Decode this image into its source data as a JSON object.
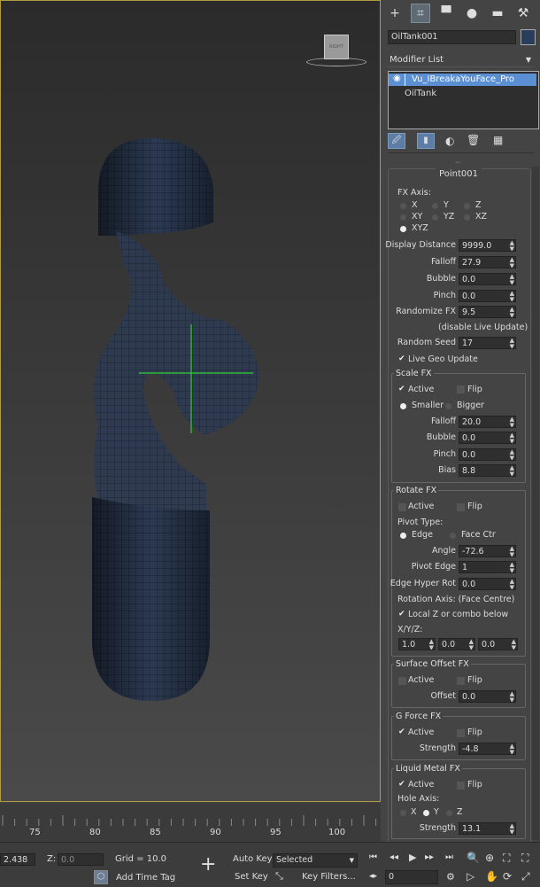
{
  "viewport": {
    "viewcube_label": "RIGHT"
  },
  "panel": {
    "tab_icons": [
      "create-icon",
      "modify-icon",
      "hierarchy-icon",
      "motion-icon",
      "display-icon",
      "utilities-icon"
    ],
    "object_name": "OilTank001",
    "modifier_list_label": "Modifier List",
    "stack": [
      "Vu_IBreakaYouFace_Pro",
      "OilTank"
    ],
    "rollout_title": "Point001",
    "fx_axis_label": "FX Axis:",
    "axis_options": [
      "X",
      "Y",
      "Z",
      "XY",
      "YZ",
      "XZ",
      "XYZ"
    ],
    "axis_selected": "XYZ",
    "display_distance_label": "Display Distance",
    "display_distance": "9999.0",
    "falloff_label": "Falloff",
    "falloff": "27.9",
    "bubble_label": "Bubble",
    "bubble": "0.0",
    "pinch_label": "Pinch",
    "pinch": "0.0",
    "randomize_fx_label": "Randomize FX",
    "randomize_fx": "9.5",
    "disable_live_update": "(disable Live Update)",
    "random_seed_label": "Random Seed",
    "random_seed": "17",
    "live_geo_update": "Live Geo Update",
    "scale_fx": {
      "title": "Scale FX",
      "active": "Active",
      "flip": "Flip",
      "smaller": "Smaller",
      "bigger": "Bigger",
      "falloff_label": "Falloff",
      "falloff": "20.0",
      "bubble_label": "Bubble",
      "bubble": "0.0",
      "pinch_label": "Pinch",
      "pinch": "0.0",
      "bias_label": "Bias",
      "bias": "8.8"
    },
    "rotate_fx": {
      "title": "Rotate FX",
      "active": "Active",
      "flip": "Flip",
      "pivot_type": "Pivot Type:",
      "edge": "Edge",
      "face_ctr": "Face Ctr",
      "angle_label": "Angle",
      "angle": "-72.6",
      "pivot_edge_label": "Pivot Edge",
      "pivot_edge": "1",
      "edge_hyper_rot_label": "Edge Hyper Rot",
      "edge_hyper_rot": "0.0",
      "rotation_axis": "Rotation Axis: (Face Centre)",
      "local_z": "Local Z or combo below",
      "xyz_label": "X/Y/Z:",
      "x": "1.0",
      "y": "0.0",
      "z": "0.0"
    },
    "surface_offset_fx": {
      "title": "Surface Offset FX",
      "active": "Active",
      "flip": "Flip",
      "offset_label": "Offset",
      "offset": "0.0"
    },
    "g_force_fx": {
      "title": "G Force FX",
      "active": "Active",
      "flip": "Flip",
      "strength_label": "Strength",
      "strength": "-4.8"
    },
    "liquid_metal_fx": {
      "title": "Liquid Metal FX",
      "active": "Active",
      "flip": "Flip",
      "hole_axis": "Hole Axis:",
      "axes": [
        "X",
        "Y",
        "Z"
      ],
      "axis_selected": "Y",
      "strength_label": "Strength",
      "strength": "13.1"
    }
  },
  "timeline": {
    "ticks": [
      "75",
      "80",
      "85",
      "90",
      "95",
      "100"
    ]
  },
  "status": {
    "x_value": "2.438",
    "z_label": "Z:",
    "z_value": "0.0",
    "grid": "Grid = 10.0",
    "add_time_tag": "Add Time Tag",
    "auto_key": "Auto Key",
    "selected": "Selected",
    "set_key": "Set Key",
    "key_filters": "Key Filters...",
    "frame": "0"
  }
}
